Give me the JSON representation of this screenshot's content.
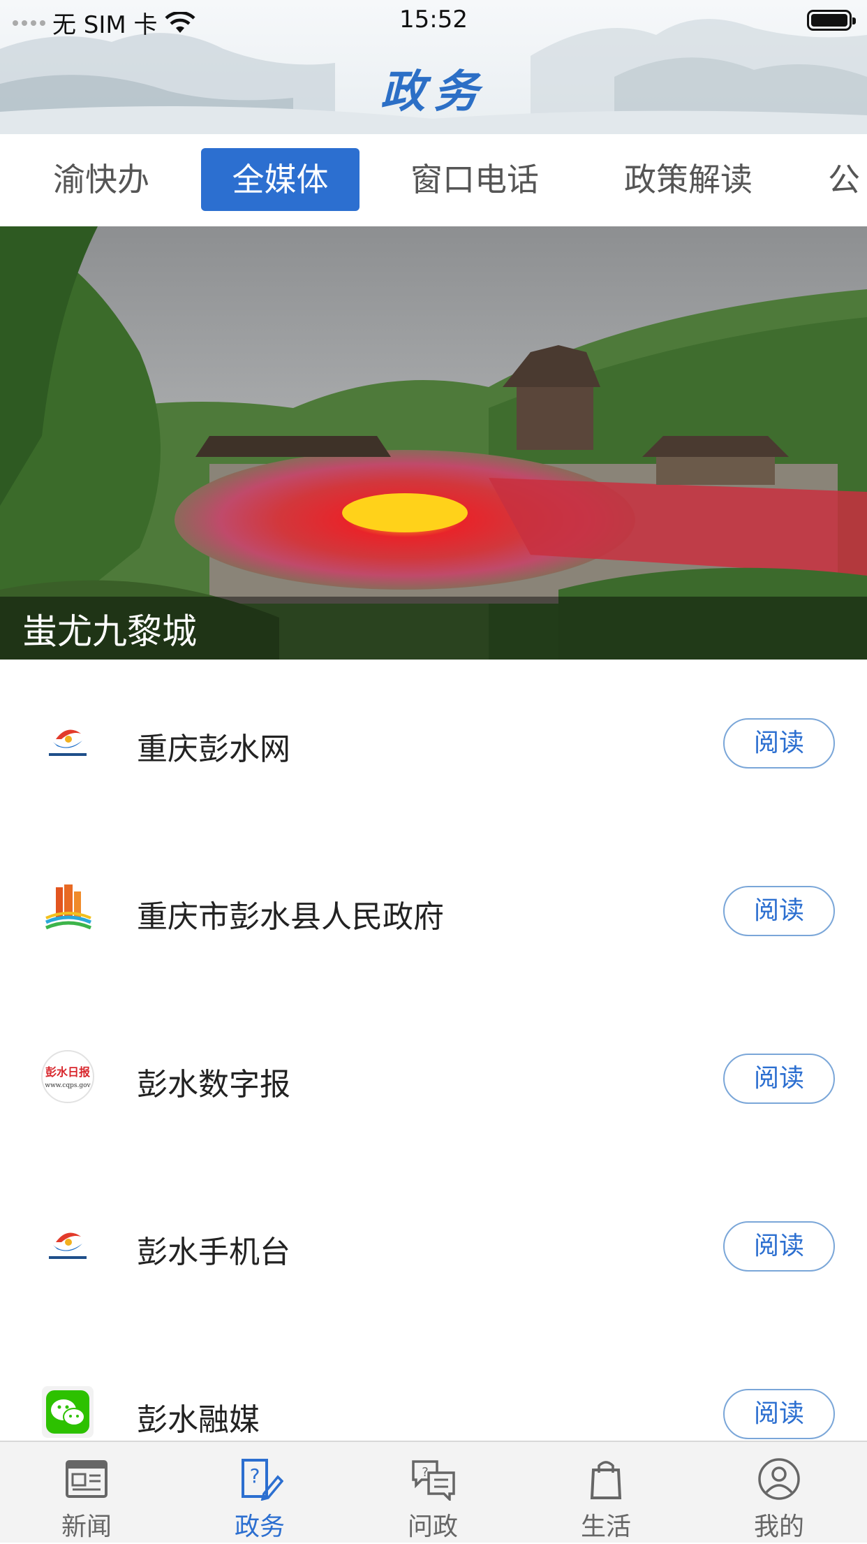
{
  "status_bar": {
    "carrier": "无 SIM 卡",
    "time": "15:52"
  },
  "header": {
    "title": "政务"
  },
  "tabs": [
    {
      "label": "渝快办"
    },
    {
      "label": "全媒体",
      "active": true
    },
    {
      "label": "窗口电话"
    },
    {
      "label": "政策解读"
    },
    {
      "label": "公"
    }
  ],
  "banner": {
    "caption": "蚩尤九黎城"
  },
  "media_list": [
    {
      "name": "重庆彭水网",
      "action": "阅读",
      "icon": "cqps-logo-icon"
    },
    {
      "name": "重庆市彭水县人民政府",
      "action": "阅读",
      "icon": "government-building-icon"
    },
    {
      "name": "彭水数字报",
      "action": "阅读",
      "icon": "pengshui-daily-logo-icon",
      "logo_text": "彭水日报",
      "logo_subtext": "www.cqps.gov"
    },
    {
      "name": "彭水手机台",
      "action": "阅读",
      "icon": "cqps-logo-icon"
    },
    {
      "name": "彭水融媒",
      "action": "阅读",
      "icon": "wechat-icon"
    }
  ],
  "bottom_nav": [
    {
      "label": "新闻",
      "icon": "newspaper-icon"
    },
    {
      "label": "政务",
      "icon": "question-document-icon",
      "active": true
    },
    {
      "label": "问政",
      "icon": "chat-bubbles-icon"
    },
    {
      "label": "生活",
      "icon": "shopping-bag-icon"
    },
    {
      "label": "我的",
      "icon": "user-profile-icon"
    }
  ],
  "colors": {
    "accent": "#2c6fd0",
    "title": "#2c6fc6",
    "read_border": "#7aa6d8"
  }
}
